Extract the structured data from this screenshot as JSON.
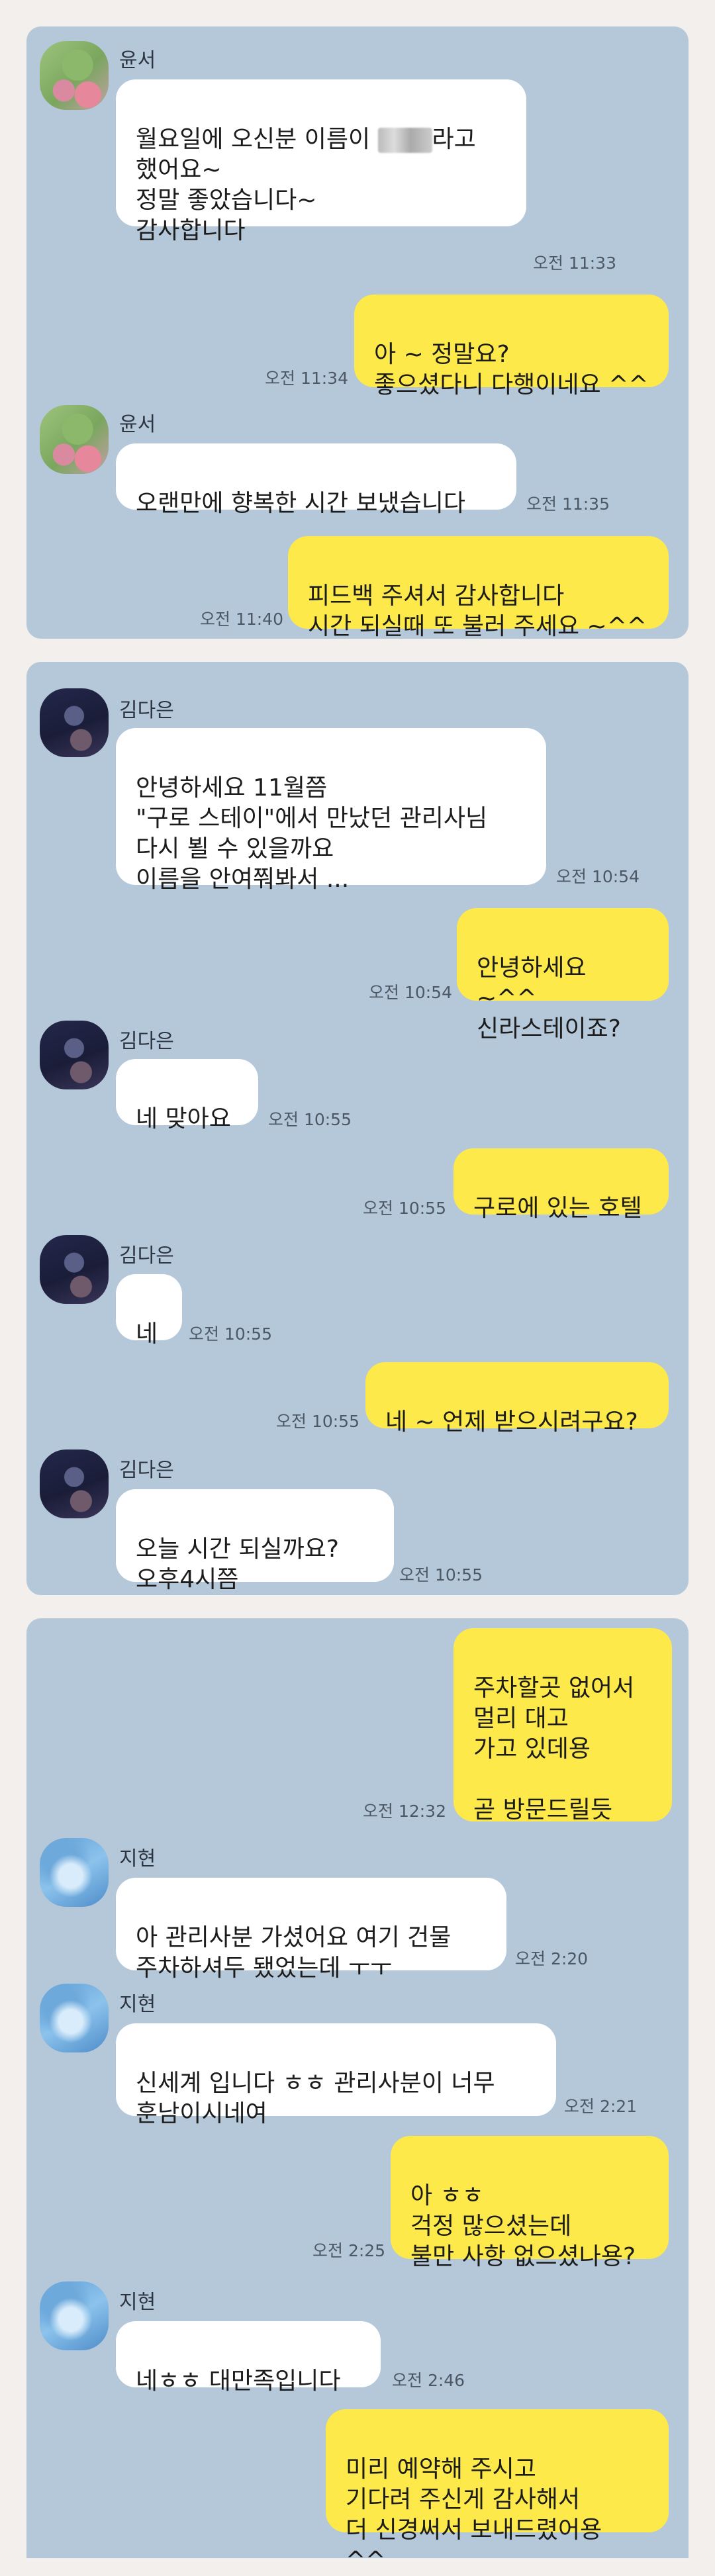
{
  "senders": {
    "yunseo": "윤서",
    "kimdaeun": "김다은",
    "jihyun": "지현"
  },
  "card1": {
    "m1": {
      "pre": "월요일에 오신분 이름이 ",
      "post": "라고\n했어요~\n정말 좋았습니다~\n감사합니다",
      "time": "오전 11:33"
    },
    "m2": {
      "text": "아 ~ 정말요?\n좋으셨다니 다행이네요 ^^",
      "time": "오전 11:34"
    },
    "m3": {
      "text": "오랜만에 향복한 시간 보냈습니다",
      "time": "오전 11:35"
    },
    "m4": {
      "text": "피드백 주셔서 감사합니다\n시간 되실때 또 불러 주세요 ~^^",
      "time": "오전 11:40"
    }
  },
  "card2": {
    "m1": {
      "text": "안녕하세요 11월쯤\n\"구로 스테이\"에서 만났던 관리사님\n다시 뵐 수 있을까요\n이름을 안여쭤봐서 ...",
      "time": "오전 10:54"
    },
    "m2": {
      "text": "안녕하세요 ~^^\n신라스테이죠?",
      "time": "오전 10:54"
    },
    "m3": {
      "text": "네 맞아요",
      "time": "오전 10:55"
    },
    "m4": {
      "text": "구로에 있는 호텔",
      "time": "오전 10:55"
    },
    "m5": {
      "text": "네",
      "time": "오전 10:55"
    },
    "m6": {
      "text": "네 ~ 언제 받으시려구요?",
      "time": "오전 10:55"
    },
    "m7": {
      "text": "오늘  시간 되실까요?\n오후4시쯤",
      "time": "오전 10:55"
    }
  },
  "card3": {
    "m1": {
      "text": "주차할곳 없어서\n멀리 대고\n가고 있데용\n\n곧 방문드릴듯",
      "time": "오전 12:32"
    },
    "m2": {
      "text": "아 관리사분 가셨어요 여기 건물\n주차하셔두 됐었는데 ㅜㅜ",
      "time": "오전 2:20"
    },
    "m3": {
      "text": "신세계 입니다 ㅎㅎ 관리사분이 너무\n훈남이시네여",
      "time": "오전 2:21"
    },
    "m4": {
      "text": "아 ㅎㅎ\n걱정 많으셨는데\n불만 사항 없으셨나용?",
      "time": "오전 2:25"
    },
    "m5": {
      "text": "네ㅎㅎ 대만족입니다",
      "time": "오전 2:46"
    },
    "m6": {
      "text": "미리 예약해 주시고\n기다려 주신게 감사해서\n더 신경써서 보내드렸어용 ^^",
      "time": ""
    }
  }
}
